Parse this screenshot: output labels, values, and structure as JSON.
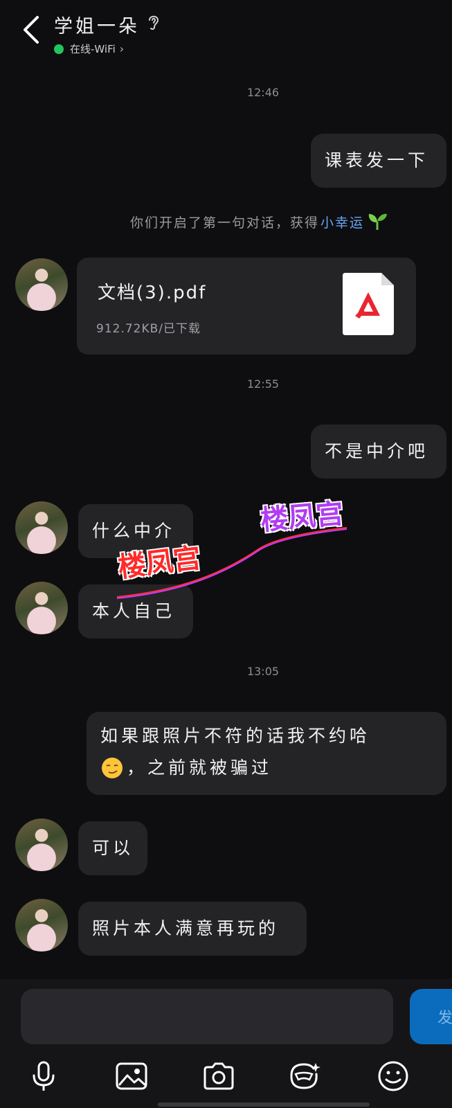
{
  "header": {
    "contact_name": "学姐一朵",
    "status": "在线-WiFi",
    "status_color": "#22c55e"
  },
  "messages": {
    "ts1": "12:46",
    "out1": "课表发一下",
    "system_text": "你们开启了第一句对话，获得",
    "system_link": "小幸运",
    "file_name": "文档(3).pdf",
    "file_meta": "912.72KB/已下载",
    "ts2": "12:55",
    "out2": "不是中介吧",
    "in1": "什么中介",
    "in2": "本人自己",
    "ts3": "13:05",
    "out3_line1": "如果跟照片不符的话我不约哈",
    "out3_line2": "，之前就被骗过",
    "in3": "可以",
    "in4": "照片本人满意再玩的"
  },
  "watermark": {
    "text_red": "楼凤宫",
    "text_purple": "楼凤宫"
  },
  "input": {
    "placeholder": "",
    "send_label": "发"
  },
  "icons": {
    "back": "chevron-left-icon",
    "ear": "ear-icon",
    "pdf": "pdf-icon",
    "voice": "microphone-icon",
    "image": "image-icon",
    "camera": "camera-icon",
    "sticker": "sticker-icon",
    "emoji": "smiley-icon"
  },
  "colors": {
    "background": "#0e0e10",
    "bubble": "#242427",
    "link": "#6aa6f5",
    "send": "#0b6cbd"
  }
}
